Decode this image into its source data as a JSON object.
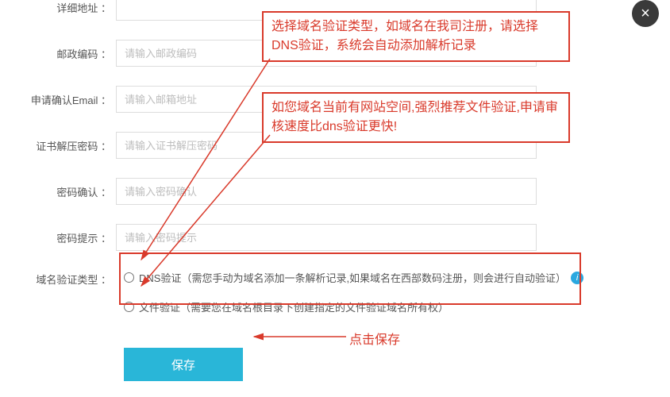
{
  "close_label": "×",
  "fields": {
    "detail_addr": {
      "label": "详细地址",
      "placeholder": ""
    },
    "postal": {
      "label": "邮政编码",
      "placeholder": "请输入邮政编码"
    },
    "email": {
      "label": "申请确认Email",
      "placeholder": "请输入邮箱地址"
    },
    "unzip_pwd": {
      "label": "证书解压密码",
      "placeholder": "请输入证书解压密码"
    },
    "pwd_confirm": {
      "label": "密码确认",
      "placeholder": "请输入密码确认"
    },
    "pwd_hint": {
      "label": "密码提示",
      "placeholder": "请输入密码提示"
    }
  },
  "verify": {
    "label": "域名验证类型",
    "dns": "DNS验证（需您手动为域名添加一条解析记录,如果域名在西部数码注册，则会进行自动验证）",
    "file": "文件验证（需要您在域名根目录下创建指定的文件验证域名所有权）"
  },
  "save_label": "保存",
  "annotations": {
    "a1": "选择域名验证类型，如域名在我司注册，请选择DNS验证，系统会自动添加解析记录",
    "a2": "如您域名当前有网站空间,强烈推荐文件验证,申请审核速度比dns验证更快!",
    "save": "点击保存"
  },
  "colors": {
    "accent": "#29b6d8",
    "anno": "#d93a2b"
  }
}
